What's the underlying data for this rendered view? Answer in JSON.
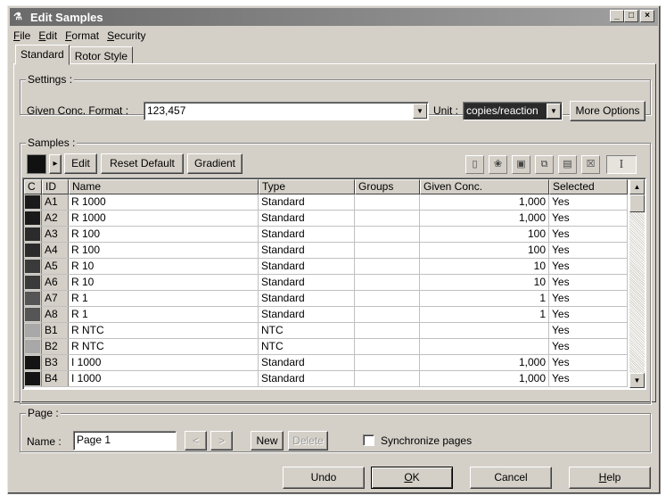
{
  "window": {
    "title": "Edit Samples",
    "min": "_",
    "max": "□",
    "close": "×"
  },
  "menu": [
    {
      "key": "F",
      "rest": "ile"
    },
    {
      "key": "E",
      "rest": "dit"
    },
    {
      "key": "F",
      "rest": "ormat"
    },
    {
      "key": "S",
      "rest": "ecurity"
    }
  ],
  "tabs": [
    "Standard",
    "Rotor Style"
  ],
  "settings": {
    "group_label": "Settings :",
    "conc_format_label": "Given Conc. Format :",
    "conc_format_value": "123,457",
    "unit_label": "Unit :",
    "unit_value": "copies/reaction",
    "more_options": "More Options"
  },
  "samples": {
    "group_label": "Samples :",
    "swatch_color": "#111111",
    "arrow": "▸",
    "edit": "Edit",
    "reset_default": "Reset Default",
    "gradient": "Gradient",
    "tool_icons": [
      "new-page-icon",
      "open-icon",
      "save-icon",
      "copy-icon",
      "paste-icon",
      "delete-icon",
      "text-cursor-icon"
    ],
    "tool_glyphs": [
      "▯",
      "❀",
      "▣",
      "⧉",
      "▤",
      "☒",
      "I"
    ],
    "columns": [
      "C",
      "ID",
      "Name",
      "Type",
      "Groups",
      "Given Conc.",
      "Selected"
    ],
    "rows": [
      {
        "color": "#1a1a1a",
        "id": "A1",
        "name": "R 1000",
        "type": "Standard",
        "groups": "",
        "conc": "1,000",
        "selected": "Yes"
      },
      {
        "color": "#1a1a1a",
        "id": "A2",
        "name": "R 1000",
        "type": "Standard",
        "groups": "",
        "conc": "1,000",
        "selected": "Yes"
      },
      {
        "color": "#2b2b2b",
        "id": "A3",
        "name": "R 100",
        "type": "Standard",
        "groups": "",
        "conc": "100",
        "selected": "Yes"
      },
      {
        "color": "#2b2b2b",
        "id": "A4",
        "name": "R 100",
        "type": "Standard",
        "groups": "",
        "conc": "100",
        "selected": "Yes"
      },
      {
        "color": "#3a3a3a",
        "id": "A5",
        "name": "R 10",
        "type": "Standard",
        "groups": "",
        "conc": "10",
        "selected": "Yes"
      },
      {
        "color": "#3a3a3a",
        "id": "A6",
        "name": "R 10",
        "type": "Standard",
        "groups": "",
        "conc": "10",
        "selected": "Yes"
      },
      {
        "color": "#555555",
        "id": "A7",
        "name": "R 1",
        "type": "Standard",
        "groups": "",
        "conc": "1",
        "selected": "Yes"
      },
      {
        "color": "#555555",
        "id": "A8",
        "name": "R 1",
        "type": "Standard",
        "groups": "",
        "conc": "1",
        "selected": "Yes"
      },
      {
        "color": "#a8a8a8",
        "id": "B1",
        "name": "R NTC",
        "type": "NTC",
        "groups": "",
        "conc": "",
        "selected": "Yes"
      },
      {
        "color": "#a8a8a8",
        "id": "B2",
        "name": "R NTC",
        "type": "NTC",
        "groups": "",
        "conc": "",
        "selected": "Yes"
      },
      {
        "color": "#141414",
        "id": "B3",
        "name": "I 1000",
        "type": "Standard",
        "groups": "",
        "conc": "1,000",
        "selected": "Yes"
      },
      {
        "color": "#141414",
        "id": "B4",
        "name": "I 1000",
        "type": "Standard",
        "groups": "",
        "conc": "1,000",
        "selected": "Yes"
      }
    ]
  },
  "page": {
    "group_label": "Page :",
    "name_label": "Name :",
    "name_value": "Page 1",
    "prev": "<",
    "next": ">",
    "new": "New",
    "delete": "Delete",
    "sync_label": "Synchronize pages"
  },
  "footer": {
    "undo": "Undo",
    "ok_key": "O",
    "ok_rest": "K",
    "cancel": "Cancel",
    "help_key": "H",
    "help_rest": "elp"
  }
}
